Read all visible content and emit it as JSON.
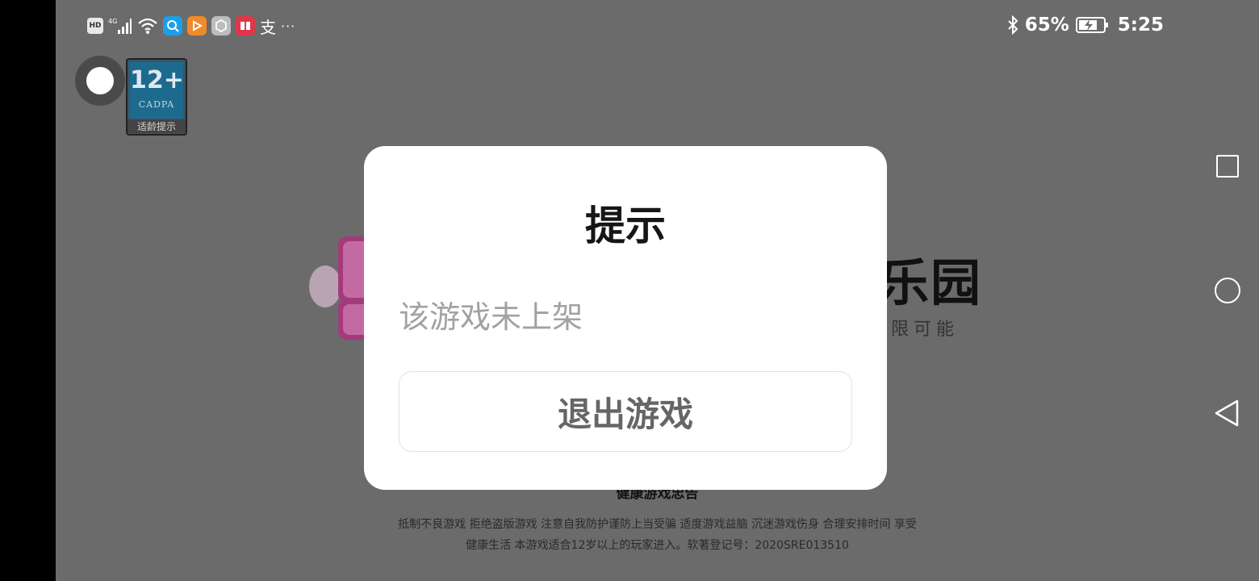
{
  "status_bar": {
    "hd_label": "HD",
    "network_label": "4G",
    "app_icons": [
      "search-app-icon",
      "video-app-icon",
      "hand-app-icon",
      "book-app-icon",
      "translate-app-icon"
    ],
    "translate_glyph": "支",
    "more_glyph": "···",
    "battery_percent": "65%",
    "time": "5:25"
  },
  "age_rating": {
    "number": "12+",
    "org": "CADPA",
    "label": "适龄提示"
  },
  "background": {
    "logo_text_right": "乐园",
    "slogan": "限可能",
    "health_title": "健康游戏忠告",
    "health_line_1": "抵制不良游戏 拒绝盗版游戏 注意自我防护谨防上当受骗 适度游戏益脑 沉迷游戏伤身 合理安排时间 享受",
    "health_line_2": "健康生活 本游戏适合12岁以上的玩家进入。软著登记号：2020SRE013510"
  },
  "dialog": {
    "title": "提示",
    "message": "该游戏未上架",
    "button_label": "退出游戏"
  },
  "colors": {
    "overlay": "#6b6b6b",
    "dialog_bg": "#ffffff",
    "title": "#161616",
    "message": "#a2a2a2",
    "button_text": "#666666"
  }
}
